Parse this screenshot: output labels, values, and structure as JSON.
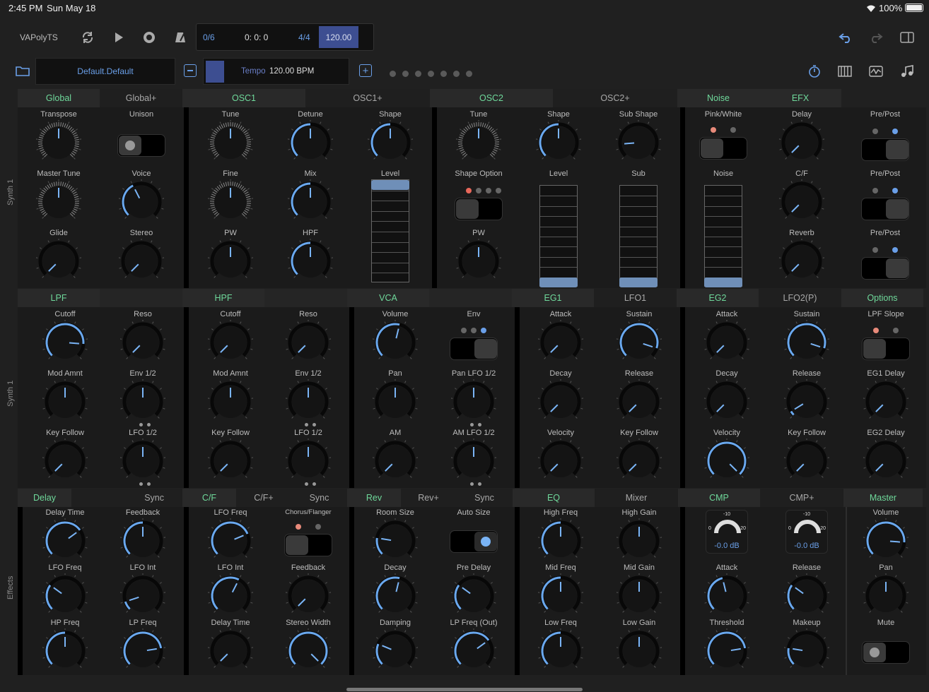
{
  "status": {
    "time": "2:45 PM",
    "date": "Sun May 18",
    "battery": "100%"
  },
  "toolbar": {
    "app_name": "VAPolyTS",
    "bar_count": "0/6",
    "position": "0: 0: 0",
    "time_sig": "4/4",
    "bpm": "120.00"
  },
  "preset": {
    "name": "Default.Default",
    "tempo_label": "Tempo",
    "tempo_value": "120.00 BPM"
  },
  "side": {
    "synth1": "Synth 1",
    "synth1b": "Synth 1",
    "effects": "Effects"
  },
  "tabs_row1": [
    "Global",
    "Global+",
    "OSC1",
    "OSC1+",
    "OSC2",
    "OSC2+",
    "Noise",
    "EFX"
  ],
  "tabs_row2": [
    "LPF",
    "",
    "HPF",
    "",
    "VCA",
    "",
    "EG1",
    "LFO1",
    "EG2",
    "LFO2(P)",
    "Options"
  ],
  "tabs_row3": [
    "Delay",
    "Sync",
    "C/F",
    "C/F+",
    "Sync",
    "Rev",
    "Rev+",
    "Sync",
    "EQ",
    "Mixer",
    "CMP",
    "CMP+",
    "Master"
  ],
  "labels1": {
    "transpose": "Transpose",
    "unison": "Unison",
    "master_tune": "Master Tune",
    "voice": "Voice",
    "glide": "Glide",
    "stereo": "Stereo",
    "o1_tune": "Tune",
    "o1_detune": "Detune",
    "o1_shape": "Shape",
    "o1_fine": "Fine",
    "o1_mix": "Mix",
    "o1_level": "Level",
    "o1_pw": "PW",
    "o1_hpf": "HPF",
    "o2_tune": "Tune",
    "o2_shape": "Shape",
    "o2_sub_shape": "Sub Shape",
    "o2_shape_option": "Shape Option",
    "o2_level": "Level",
    "o2_sub": "Sub",
    "o2_pw": "PW",
    "pink_white": "Pink/White",
    "noise": "Noise",
    "delay": "Delay",
    "prepost1": "Pre/Post",
    "cf": "C/F",
    "prepost2": "Pre/Post",
    "reverb": "Reverb",
    "prepost3": "Pre/Post"
  },
  "labels2": {
    "lpf_cutoff": "Cutoff",
    "lpf_reso": "Reso",
    "lpf_mod": "Mod Amnt",
    "lpf_env": "Env 1/2",
    "lpf_key": "Key Follow",
    "lpf_lfo": "LFO 1/2",
    "hpf_cutoff": "Cutoff",
    "hpf_reso": "Reso",
    "hpf_mod": "Mod Amnt",
    "hpf_env": "Env 1/2",
    "hpf_key": "Key Follow",
    "hpf_lfo": "LFO 1/2",
    "vca_volume": "Volume",
    "vca_env": "Env",
    "vca_pan": "Pan",
    "vca_panlfo": "Pan LFO 1/2",
    "vca_am": "AM",
    "vca_amlfo": "AM LFO 1/2",
    "eg1_attack": "Attack",
    "eg1_sustain": "Sustain",
    "eg1_decay": "Decay",
    "eg1_release": "Release",
    "eg1_velocity": "Velocity",
    "eg1_key": "Key Follow",
    "eg2_attack": "Attack",
    "eg2_sustain": "Sustain",
    "eg2_decay": "Decay",
    "eg2_release": "Release",
    "eg2_velocity": "Velocity",
    "eg2_key": "Key Follow",
    "lpf_slope": "LPF Slope",
    "eg1_delay": "EG1 Delay",
    "eg2_delay": "EG2 Delay"
  },
  "labels3": {
    "delay_time": "Delay Time",
    "feedback": "Feedback",
    "lfo_freq": "LFO Freq",
    "lfo_int": "LFO Int",
    "hp_freq": "HP Freq",
    "lp_freq": "LP Freq",
    "cf_lfo_freq": "LFO Freq",
    "chorus_flanger": "Chorus/Flanger",
    "cf_lfo_int": "LFO Int",
    "cf_feedback": "Feedback",
    "cf_delay_time": "Delay Time",
    "stereo_width": "Stereo Width",
    "room_size": "Room Size",
    "auto_size": "Auto Size",
    "decay": "Decay",
    "pre_delay": "Pre Delay",
    "damping": "Damping",
    "lp_freq_out": "LP Freq (Out)",
    "high_freq": "High Freq",
    "high_gain": "High Gain",
    "mid_freq": "Mid Freq",
    "mid_gain": "Mid Gain",
    "low_freq": "Low Freq",
    "low_gain": "Low Gain",
    "attack": "Attack",
    "release": "Release",
    "threshold": "Threshold",
    "makeup": "Makeup",
    "volume": "Volume",
    "pan": "Pan",
    "mute": "Mute"
  },
  "meters": {
    "scale_top": "-10",
    "scale_left": "0",
    "scale_right": "-20",
    "value_a": "-0.0 dB",
    "value_b": "-0.0 dB"
  },
  "colors": {
    "accent": "#6fd99b",
    "knob": "#5b9be6",
    "toggle_on": "#6a9fe8",
    "dot_red": "#e88a7a"
  }
}
